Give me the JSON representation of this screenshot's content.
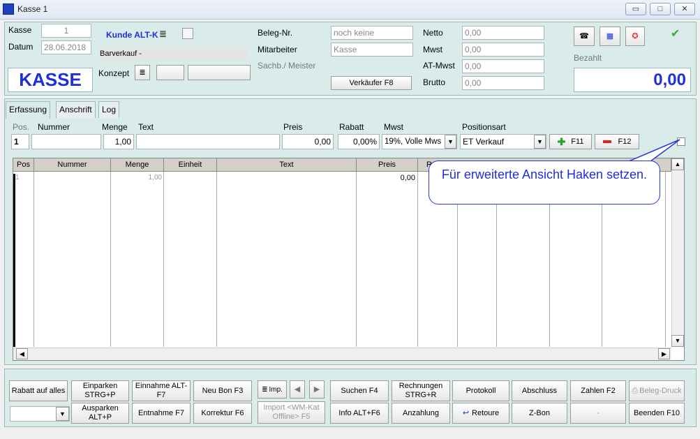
{
  "window": {
    "title": "Kasse 1",
    "min": "▭",
    "max": "□",
    "close": "✕"
  },
  "header": {
    "kasse_label": "Kasse",
    "kasse_value": "1",
    "datum_label": "Datum",
    "datum_value": "28.06.2018",
    "kunde": "Kunde ALT-K",
    "kunde_menu": "≣",
    "barverkauf": "Barverkauf -",
    "konzept_label": "Konzept",
    "konzept_menu": "≣",
    "big_label": "KASSE",
    "beleg_label": "Beleg-Nr.",
    "beleg_value": "noch keine",
    "mitarbeiter_label": "Mitarbeiter",
    "mitarbeiter_value": "Kasse",
    "sachb_label": "Sachb./ Meister",
    "verkaeufer_button": "Verkäufer F8",
    "netto_label": "Netto",
    "netto_value": "0,00",
    "mwst_label": "Mwst",
    "mwst_value": "0,00",
    "atmwst_label": "AT-Mwst",
    "atmwst_value": "0,00",
    "brutto_label": "Brutto",
    "brutto_value": "0,00",
    "bezahlt_label": "Bezahlt",
    "bezahlt_value": "0,00"
  },
  "tabs": [
    "Erfassung",
    "Anschrift",
    "Log"
  ],
  "entry": {
    "pos_label": "Pos.",
    "nummer_label": "Nummer",
    "menge_label": "Menge",
    "text_label": "Text",
    "preis_label": "Preis",
    "rabatt_label": "Rabatt",
    "mwst_label": "Mwst",
    "positionsart_label": "Positionsart",
    "pos_value": "1",
    "nummer_value": "",
    "menge_value": "1,00",
    "text_value": "",
    "preis_value": "0,00",
    "rabatt_value": "0,00%",
    "mwst_value": "19%, Volle Mws",
    "positionsart_value": "ET Verkauf",
    "add_button": "F11",
    "remove_button": "F12"
  },
  "grid": {
    "columns": [
      "Pos",
      "Nummer",
      "Menge",
      "Einheit",
      "Text",
      "Preis",
      "R"
    ],
    "rows": [
      {
        "pos": "1",
        "menge": "1,00",
        "preis": "0,00"
      }
    ]
  },
  "callout": "Für erweiterte Ansicht Haken setzen.",
  "footer": {
    "rabatt": "Rabatt auf alles",
    "einparken": "Einparken STRG+P",
    "ausparken": "Ausparken ALT+P",
    "einnahme": "Einnahme ALT-F7",
    "entnahme": "Entnahme F7",
    "neubon": "Neu Bon F3",
    "korrektur": "Korrektur F6",
    "imp": "Imp.",
    "import": "Import <WM-Kat Offline> F5",
    "suchen": "Suchen F4",
    "info": "Info ALT+F6",
    "rechnungen": "Rechnungen STRG+R",
    "anzahlung": "Anzahlung",
    "protokoll": "Protokoll",
    "retoure": "Retoure",
    "abschluss": "Abschluss",
    "zbon": "Z-Bon",
    "zahlen": "Zahlen F2",
    "dash": "-",
    "belegdruck": "Beleg-Druck",
    "beenden": "Beenden F10"
  }
}
